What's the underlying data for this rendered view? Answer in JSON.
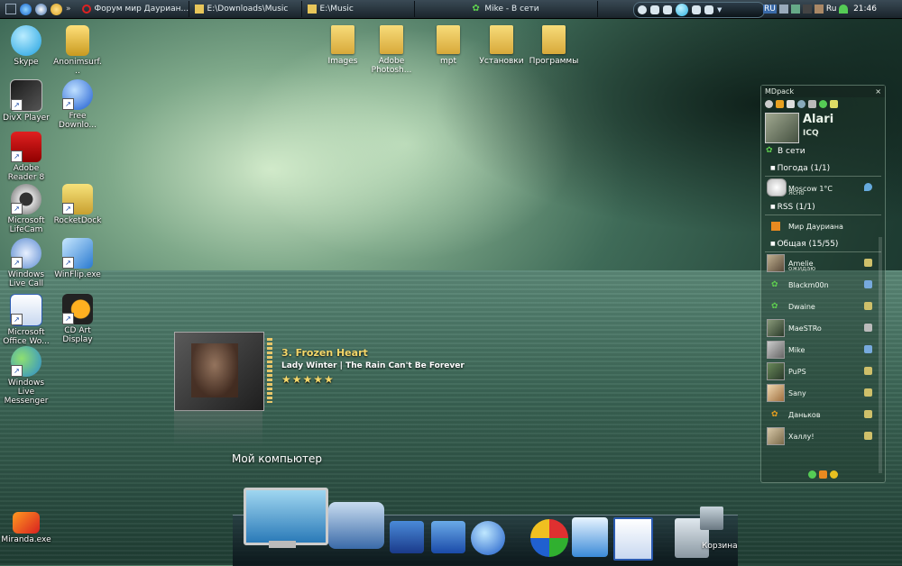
{
  "taskbar": {
    "tasks": [
      {
        "label": "Форум мир Дауриан...",
        "icon": "opera-icon"
      },
      {
        "label": "E:\\Downloads\\Music",
        "icon": "folder-icon"
      },
      {
        "label": "E:\\Music",
        "icon": "folder-icon"
      },
      {
        "label": "Mike - В сети",
        "icon": "miranda-icon"
      }
    ],
    "quick_more": "»",
    "lang": "RU",
    "lang2": "Ru",
    "clock": "21:46"
  },
  "desktop_icons": [
    {
      "name": "skype",
      "label": "Skype"
    },
    {
      "name": "anonimsurf",
      "label": "Anonimsurf..."
    },
    {
      "name": "divx-player",
      "label": "DivX Player"
    },
    {
      "name": "free-download",
      "label": "Free Downlo..."
    },
    {
      "name": "adobe-reader",
      "label": "Adobe Reader 8"
    },
    {
      "name": "microsoft-lifecam",
      "label": "Microsoft LifeCam"
    },
    {
      "name": "rocketdock",
      "label": "RocketDock"
    },
    {
      "name": "windows-live-call",
      "label": "Windows Live Call"
    },
    {
      "name": "winflip",
      "label": "WinFlip.exe"
    },
    {
      "name": "office-word",
      "label": "Microsoft Office Wo..."
    },
    {
      "name": "cd-art-display",
      "label": "CD Art Display"
    },
    {
      "name": "windows-live-messenger",
      "label": "Windows Live Messenger"
    },
    {
      "name": "miranda",
      "label": "Miranda.exe"
    }
  ],
  "folders": [
    {
      "label": "Images"
    },
    {
      "label": "Adobe Photosh..."
    },
    {
      "label": "mpt"
    },
    {
      "label": "Установки"
    },
    {
      "label": "Программы"
    }
  ],
  "now_playing": {
    "track": "3. Frozen Heart",
    "artist_album": "Lady Winter | The Rain Can't Be Forever",
    "stars": "★★★★★",
    "rating": 5
  },
  "my_computer": "Мой компьютер",
  "dock": {
    "trash_label": "Корзина"
  },
  "miranda": {
    "title": "MDpack",
    "close": "×",
    "nick": "Alari",
    "protocol": "ICQ",
    "status": "В сети",
    "groups": [
      {
        "name": "Погода (1/1)",
        "items": [
          {
            "name": "Moscow  1°C",
            "sub": "Ясно"
          }
        ]
      },
      {
        "name": "RSS (1/1)",
        "items": [
          {
            "name": "Мир Дауриана"
          }
        ]
      },
      {
        "name": "Общая (15/55)",
        "items": [
          {
            "name": "Amelie",
            "sub": "ожидаю"
          },
          {
            "name": "Blackm00n"
          },
          {
            "name": "Dwaine"
          },
          {
            "name": "MaeSTRo"
          },
          {
            "name": "Mike"
          },
          {
            "name": "PuPS"
          },
          {
            "name": "Sany"
          },
          {
            "name": "Даньков"
          },
          {
            "name": "Халлу!"
          }
        ]
      }
    ]
  }
}
